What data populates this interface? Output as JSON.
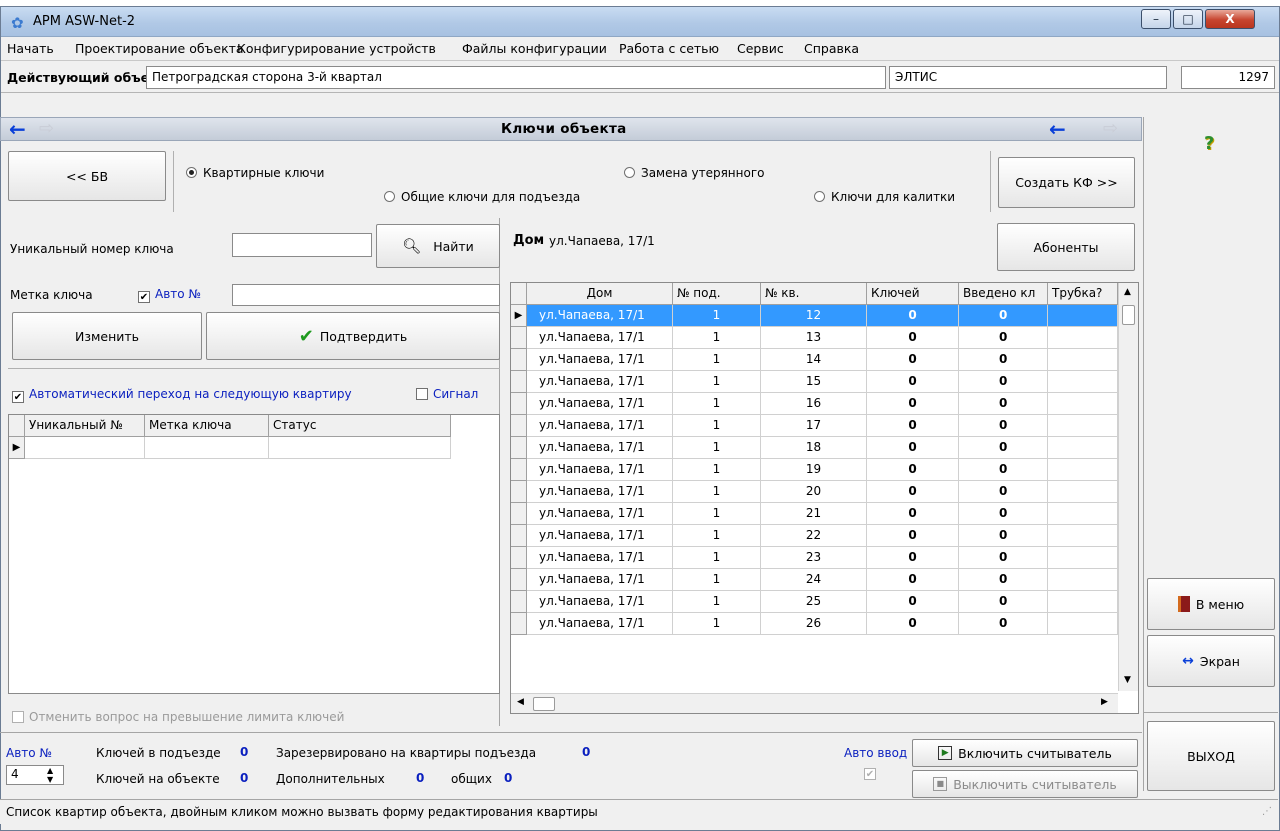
{
  "window": {
    "title": "АРМ ASW-Net-2",
    "btn_min": "–",
    "btn_max": "□",
    "btn_close": "X"
  },
  "menu": [
    "Начать",
    "Проектирование объекта",
    "Конфигурирование устройств",
    "Файлы конфигурации",
    "Работа с сетью",
    "Сервис",
    "Справка"
  ],
  "object": {
    "label": "Действующий объект",
    "name": "Петроградская сторона 3-й квартал",
    "company": "ЭЛТИС",
    "number": "1297"
  },
  "nav": {
    "title": "Ключи объекта",
    "back": "←",
    "forward": "⇨"
  },
  "help": "?",
  "modes": {
    "bv_button": "<< БВ",
    "create_button": "Создать КФ >>",
    "opt_apartment": "Квартирные ключи",
    "opt_replace": "Замена утерянного",
    "opt_common": "Общие ключи для подъезда",
    "opt_gate": "Ключи для калитки",
    "selected": "Квартирные ключи"
  },
  "left": {
    "unique_label": "Уникальный номер ключа",
    "unique_value": "",
    "find_button": "Найти",
    "mark_label": "Метка ключа",
    "auto_label": "Авто №",
    "auto_checked": "✔",
    "mark_value": "",
    "change_button": "Изменить",
    "confirm_button": "Подтвердить",
    "auto_next_label": "Автоматический переход на следующую квартиру",
    "auto_next_checked": "✔",
    "signal_label": "Сигнал",
    "columns": [
      "Уникальный №",
      "Метка ключа",
      "Статус"
    ],
    "cancel_limit_label": "Отменить вопрос на превышение лимита ключей"
  },
  "house": {
    "label": "Дом",
    "address": "ул.Чапаева, 17/1",
    "subscribers_button": "Абоненты"
  },
  "table": {
    "columns": [
      "Дом",
      "№ под.",
      "№ кв.",
      "Ключей",
      "Введено кл",
      "Трубка?"
    ],
    "rows": [
      [
        "ул.Чапаева, 17/1",
        "1",
        "12",
        "0",
        "0",
        ""
      ],
      [
        "ул.Чапаева, 17/1",
        "1",
        "13",
        "0",
        "0",
        ""
      ],
      [
        "ул.Чапаева, 17/1",
        "1",
        "14",
        "0",
        "0",
        ""
      ],
      [
        "ул.Чапаева, 17/1",
        "1",
        "15",
        "0",
        "0",
        ""
      ],
      [
        "ул.Чапаева, 17/1",
        "1",
        "16",
        "0",
        "0",
        ""
      ],
      [
        "ул.Чапаева, 17/1",
        "1",
        "17",
        "0",
        "0",
        ""
      ],
      [
        "ул.Чапаева, 17/1",
        "1",
        "18",
        "0",
        "0",
        ""
      ],
      [
        "ул.Чапаева, 17/1",
        "1",
        "19",
        "0",
        "0",
        ""
      ],
      [
        "ул.Чапаева, 17/1",
        "1",
        "20",
        "0",
        "0",
        ""
      ],
      [
        "ул.Чапаева, 17/1",
        "1",
        "21",
        "0",
        "0",
        ""
      ],
      [
        "ул.Чапаева, 17/1",
        "1",
        "22",
        "0",
        "0",
        ""
      ],
      [
        "ул.Чапаева, 17/1",
        "1",
        "23",
        "0",
        "0",
        ""
      ],
      [
        "ул.Чапаева, 17/1",
        "1",
        "24",
        "0",
        "0",
        ""
      ],
      [
        "ул.Чапаева, 17/1",
        "1",
        "25",
        "0",
        "0",
        ""
      ],
      [
        "ул.Чапаева, 17/1",
        "1",
        "26",
        "0",
        "0",
        ""
      ]
    ]
  },
  "bottom": {
    "auto_no_label": "Авто №",
    "auto_no_value": "4",
    "keys_entrance_label": "Ключей в подъезде",
    "keys_entrance_value": "0",
    "reserved_label": "Зарезервировано на квартиры подъезда",
    "reserved_value": "0",
    "keys_object_label": "Ключей на объекте",
    "keys_object_value": "0",
    "additional_label": "Дополнительных",
    "additional_value": "0",
    "common_label": "общих",
    "common_value": "0",
    "auto_input_label": "Авто ввод",
    "auto_input_checked": "✔",
    "reader_on": "Включить считыватель",
    "reader_off": "Выключить считыватель"
  },
  "sidebar": {
    "menu_button": "В меню",
    "screen_button": "Экран",
    "exit_button": "ВЫХОД"
  },
  "status": "Список квартир объекта, двойным кликом можно вызвать форму редактирования квартиры"
}
